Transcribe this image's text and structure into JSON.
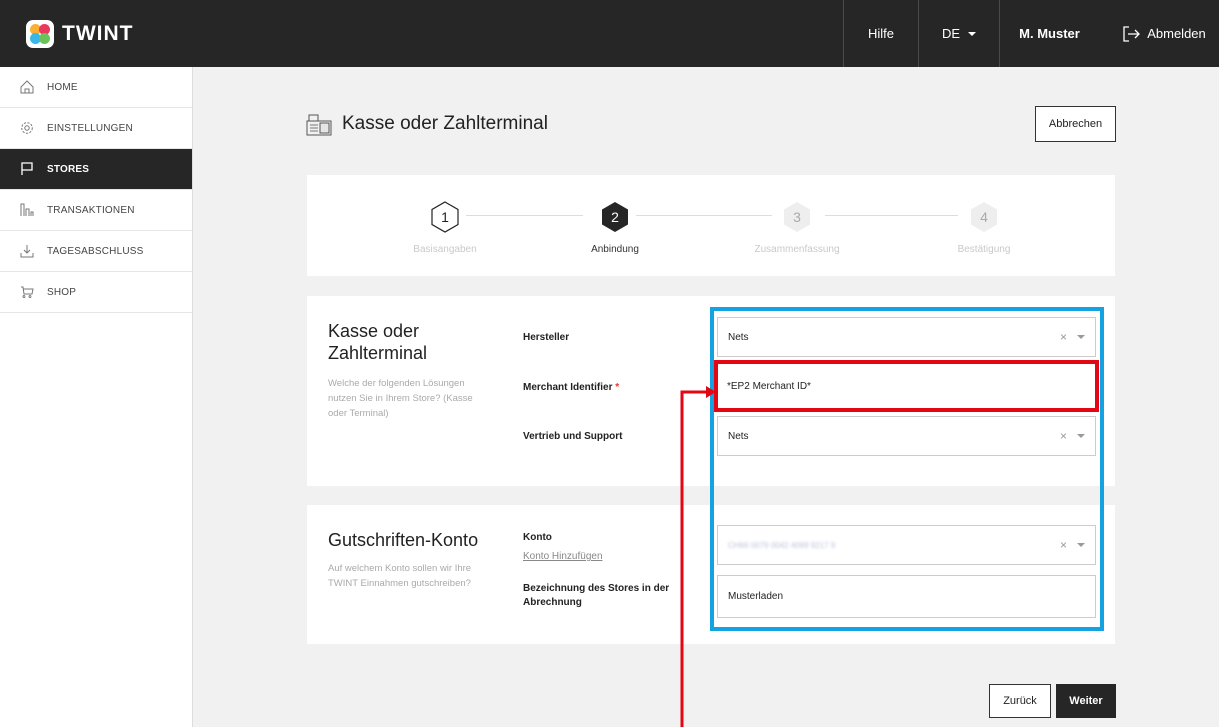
{
  "header": {
    "logo_text": "TWINT",
    "help_label": "Hilfe",
    "language_label": "DE",
    "user_name": "M. Muster",
    "logout_label": "Abmelden"
  },
  "sidebar": {
    "items": [
      {
        "label": "HOME",
        "icon": "home-icon"
      },
      {
        "label": "EINSTELLUNGEN",
        "icon": "gear-icon"
      },
      {
        "label": "STORES",
        "icon": "flag-icon",
        "active": true
      },
      {
        "label": "TRANSAKTIONEN",
        "icon": "bar-chart-icon"
      },
      {
        "label": "TAGESABSCHLUSS",
        "icon": "download-icon"
      },
      {
        "label": "SHOP",
        "icon": "cart-icon"
      }
    ]
  },
  "page": {
    "title": "Kasse oder Zahlterminal",
    "cancel_label": "Abbrechen"
  },
  "stepper": {
    "steps": [
      {
        "number": "1",
        "label": "Basisangaben",
        "state": "done"
      },
      {
        "number": "2",
        "label": "Anbindung",
        "state": "current"
      },
      {
        "number": "3",
        "label": "Zusammenfassung",
        "state": "pending"
      },
      {
        "number": "4",
        "label": "Bestätigung",
        "state": "pending"
      }
    ]
  },
  "section_terminal": {
    "title": "Kasse oder Zahlterminal",
    "description": "Welche der folgenden Lösungen nutzen Sie in Ihrem Store? (Kasse oder Terminal)",
    "fields": {
      "hersteller": {
        "label": "Hersteller",
        "value": "Nets"
      },
      "merchant_identifier": {
        "label": "Merchant Identifier",
        "required_mark": "*",
        "value": "*EP2 Merchant ID*"
      },
      "vertrieb": {
        "label": "Vertrieb und Support",
        "value": "Nets"
      }
    }
  },
  "section_account": {
    "title": "Gutschriften-Konto",
    "description": "Auf welchem Konto sollen wir Ihre TWINT Einnahmen gutschreiben?",
    "fields": {
      "konto": {
        "label": "Konto",
        "link": "Konto Hinzufügen",
        "value": "CH66 0079 0042 4099 9217 9"
      },
      "bezeichnung": {
        "label": "Bezeichnung des Stores in der Abrechnung",
        "value": "Musterladen"
      }
    }
  },
  "footer": {
    "back_label": "Zurück",
    "next_label": "Weiter"
  },
  "colors": {
    "topbar": "#262626",
    "highlight_blue": "#14a3e0",
    "highlight_red": "#e30613"
  }
}
